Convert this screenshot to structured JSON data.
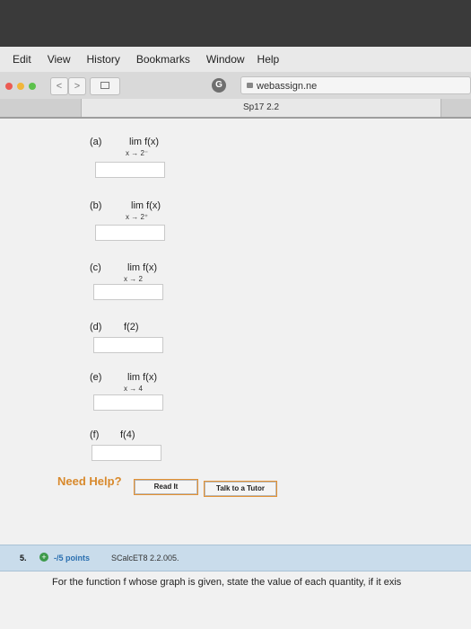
{
  "menubar": {
    "items": [
      "Edit",
      "View",
      "History",
      "Bookmarks",
      "Window",
      "Help"
    ]
  },
  "toolbar": {
    "back_label": "<",
    "forward_label": ">",
    "ext_label": "G",
    "url": "webassign.ne"
  },
  "tab": {
    "title": "Sp17 2.2"
  },
  "questions": [
    {
      "letter": "(a)",
      "expr": "lim  f(x)",
      "sub": "x → 2⁻"
    },
    {
      "letter": "(b)",
      "expr": "lim  f(x)",
      "sub": "x → 2⁺"
    },
    {
      "letter": "(c)",
      "expr": "lim  f(x)",
      "sub": "x → 2"
    },
    {
      "letter": "(d)",
      "expr": "f(2)",
      "sub": ""
    },
    {
      "letter": "(e)",
      "expr": "lim  f(x)",
      "sub": "x → 4"
    },
    {
      "letter": "(f)",
      "expr": "f(4)",
      "sub": ""
    }
  ],
  "help": {
    "need_help": "Need Help?",
    "read_it": "Read It",
    "talk_to_tutor": "Talk to a Tutor"
  },
  "next_question": {
    "number": "5.",
    "points": "-/5 points",
    "code": "SCalcET8 2.2.005.",
    "prompt": "For the function f whose graph is given, state the value of each quantity, if it exis"
  },
  "colors": {
    "accent_orange": "#d8892c",
    "header_blue": "#c9dceb",
    "points_blue": "#2a6fb0",
    "plus_green": "#3c9a4a"
  }
}
